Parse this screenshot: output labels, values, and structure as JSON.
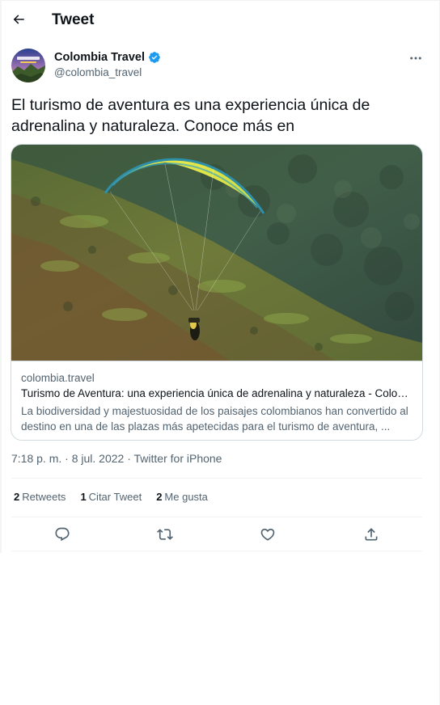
{
  "header": {
    "title": "Tweet",
    "back_icon": "arrow-left-icon"
  },
  "author": {
    "name": "Colombia Travel",
    "handle": "@colombia_travel",
    "verified_color": "#1d9bf0"
  },
  "tweet": {
    "text": "El turismo de aventura es una experiencia única de adrenalina y naturaleza. Conoce más en"
  },
  "card": {
    "domain": "colombia.travel",
    "title": "Turismo de Aventura: una experiencia única de adrenalina y naturaleza - Colom...",
    "description": "La biodiversidad y majestuosidad de los paisajes colombianos han convertido al destino en una de las plazas más apetecidas para el turismo de aventura, ..."
  },
  "meta": {
    "time": "7:18 p. m.",
    "separator1": " · ",
    "date": "8 jul. 2022",
    "separator2": " · ",
    "source": "Twitter for iPhone"
  },
  "stats": {
    "retweets_count": "2",
    "retweets_label": "Retweets",
    "quotes_count": "1",
    "quotes_label": "Citar Tweet",
    "likes_count": "2",
    "likes_label": "Me gusta"
  },
  "actions": [
    "reply-icon",
    "retweet-icon",
    "like-icon",
    "share-icon"
  ],
  "colors": {
    "accent": "#1d9bf0",
    "text": "#0f1419",
    "secondary": "#536471",
    "border": "#cfd9de"
  }
}
